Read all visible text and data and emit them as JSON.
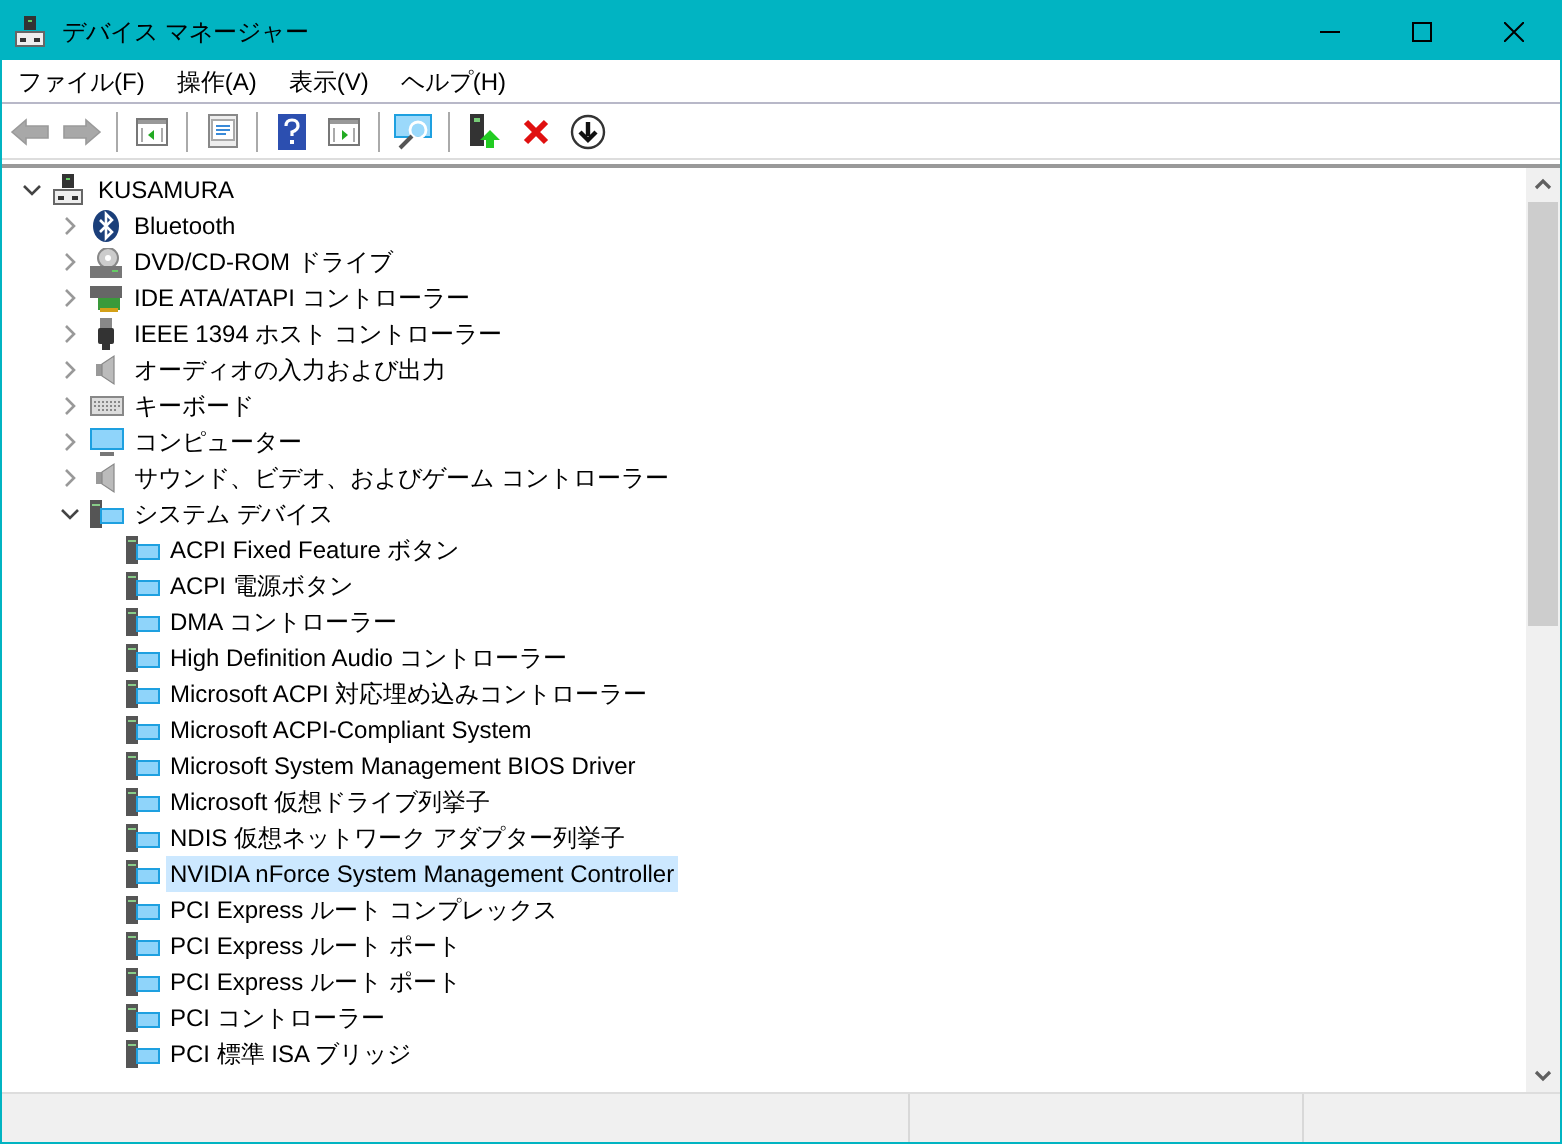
{
  "window": {
    "title": "デバイス マネージャー"
  },
  "menu": [
    {
      "label": "ファイル(F)"
    },
    {
      "label": "操作(A)"
    },
    {
      "label": "表示(V)"
    },
    {
      "label": "ヘルプ(H)"
    }
  ],
  "toolbar": [
    {
      "kind": "back",
      "disabled": true
    },
    {
      "kind": "forward",
      "disabled": true
    },
    {
      "kind": "separator"
    },
    {
      "kind": "tree"
    },
    {
      "kind": "separator"
    },
    {
      "kind": "properties"
    },
    {
      "kind": "separator"
    },
    {
      "kind": "help"
    },
    {
      "kind": "pane"
    },
    {
      "kind": "separator"
    },
    {
      "kind": "scan"
    },
    {
      "kind": "separator"
    },
    {
      "kind": "update"
    },
    {
      "kind": "uninstall"
    },
    {
      "kind": "download"
    }
  ],
  "tree": {
    "label": "KUSAMURA",
    "expanded": true,
    "selected": false,
    "children": [
      {
        "label": "Bluetooth",
        "kind": "bluetooth",
        "expanded": false,
        "selected": false
      },
      {
        "label": "DVD/CD-ROM ドライブ",
        "kind": "disc",
        "expanded": false,
        "selected": false
      },
      {
        "label": "IDE ATA/ATAPI コントローラー",
        "kind": "ide",
        "expanded": false,
        "selected": false
      },
      {
        "label": "IEEE 1394 ホスト コントローラー",
        "kind": "plug",
        "expanded": false,
        "selected": false
      },
      {
        "label": "オーディオの入力および出力",
        "kind": "speaker",
        "expanded": false,
        "selected": false
      },
      {
        "label": "キーボード",
        "kind": "keyboard",
        "expanded": false,
        "selected": false
      },
      {
        "label": "コンピューター",
        "kind": "monitor",
        "expanded": false,
        "selected": false
      },
      {
        "label": "サウンド、ビデオ、およびゲーム コントローラー",
        "kind": "speaker",
        "expanded": false,
        "selected": false
      },
      {
        "label": "システム デバイス",
        "kind": "system",
        "expanded": true,
        "selected": false,
        "children": [
          {
            "label": "ACPI Fixed Feature ボタン",
            "selected": false
          },
          {
            "label": "ACPI 電源ボタン",
            "selected": false
          },
          {
            "label": "DMA コントローラー",
            "selected": false
          },
          {
            "label": "High Definition Audio コントローラー",
            "selected": false
          },
          {
            "label": "Microsoft ACPI 対応埋め込みコントローラー",
            "selected": false
          },
          {
            "label": "Microsoft ACPI-Compliant System",
            "selected": false
          },
          {
            "label": "Microsoft System Management BIOS Driver",
            "selected": false
          },
          {
            "label": "Microsoft 仮想ドライブ列挙子",
            "selected": false
          },
          {
            "label": "NDIS 仮想ネットワーク アダプター列挙子",
            "selected": false
          },
          {
            "label": "NVIDIA nForce System Management Controller",
            "selected": true
          },
          {
            "label": "PCI Express ルート コンプレックス",
            "selected": false
          },
          {
            "label": "PCI Express ルート ポート",
            "selected": false
          },
          {
            "label": "PCI Express ルート ポート",
            "selected": false
          },
          {
            "label": "PCI コントローラー",
            "selected": false
          },
          {
            "label": "PCI 標準 ISA ブリッジ",
            "selected": false
          }
        ]
      }
    ]
  }
}
